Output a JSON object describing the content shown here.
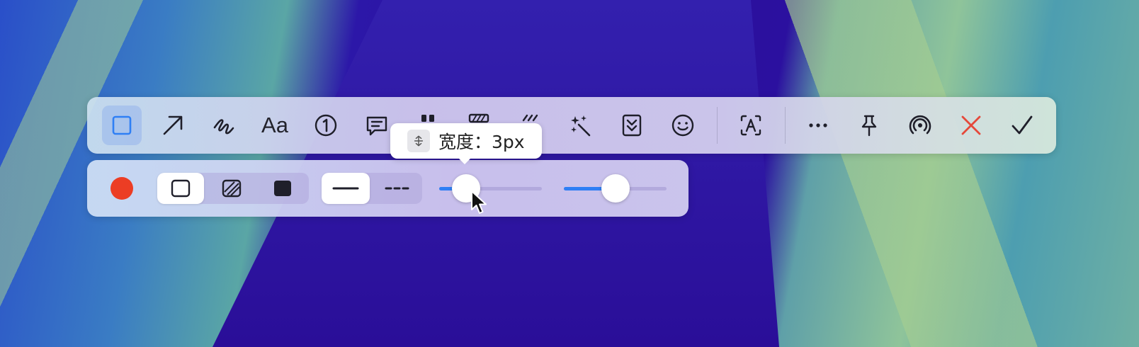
{
  "toolbar": {
    "tools": [
      {
        "name": "rectangle-icon",
        "active": true
      },
      {
        "name": "arrow-icon"
      },
      {
        "name": "pen-icon"
      },
      {
        "name": "text-tool",
        "label": "Aa"
      },
      {
        "name": "step-number-icon"
      },
      {
        "name": "speech-bubble-icon"
      },
      {
        "name": "highlighter-icon"
      },
      {
        "name": "mosaic-icon"
      },
      {
        "name": "blur-lines-icon"
      },
      {
        "name": "magic-wand-icon"
      },
      {
        "name": "scroll-capture-icon"
      },
      {
        "name": "emoji-icon"
      },
      {
        "name": "ocr-text-icon"
      },
      {
        "name": "more-icon"
      },
      {
        "name": "pin-icon"
      },
      {
        "name": "broadcast-icon"
      },
      {
        "name": "close-icon"
      },
      {
        "name": "confirm-check-icon"
      }
    ],
    "text_label": "Aa",
    "close_color": "#e5483a"
  },
  "subbar": {
    "color": "#ec3d24",
    "fill_styles": [
      "outline",
      "hatched",
      "solid"
    ],
    "selected_fill": "outline",
    "line_styles": [
      "solid",
      "dashed"
    ],
    "selected_line": "solid",
    "width_slider_value": 0.26,
    "opacity_slider_value": 0.5
  },
  "tooltip": {
    "text": "宽度：3px"
  },
  "accent": "#2f7ff5"
}
